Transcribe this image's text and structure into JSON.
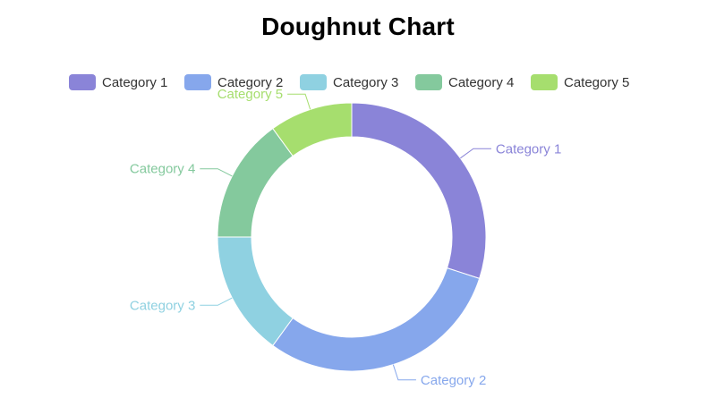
{
  "chart_data": {
    "type": "pie",
    "variant": "doughnut",
    "title": "Doughnut Chart",
    "categories": [
      "Category 1",
      "Category 2",
      "Category 3",
      "Category 4",
      "Category 5"
    ],
    "values": [
      30,
      30,
      15,
      15,
      10
    ],
    "colors": [
      "#8a84d8",
      "#86a7ec",
      "#8fd1e1",
      "#84c99d",
      "#a6de6e"
    ],
    "legend_position": "top",
    "label_position": "outside"
  }
}
